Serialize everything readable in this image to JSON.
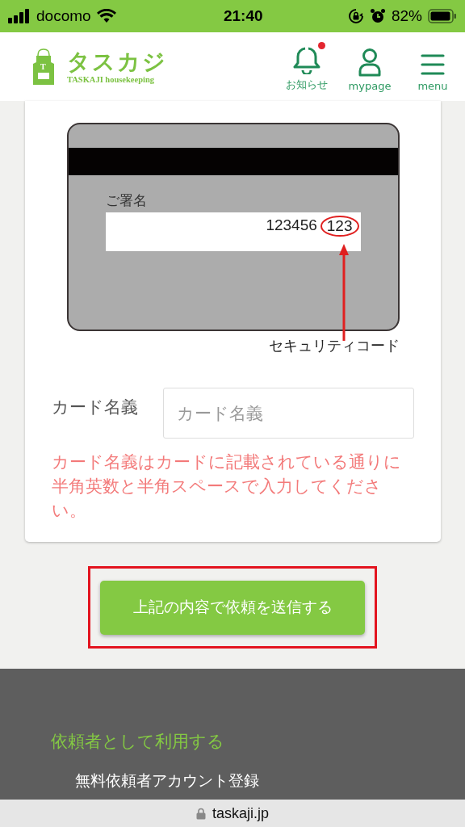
{
  "status_bar": {
    "carrier": "docomo",
    "time": "21:40",
    "battery": "82%"
  },
  "header": {
    "logo_mark": "T",
    "logo_title": "タスカジ",
    "logo_subtitle": "TASKAJI housekeeping",
    "nav": [
      {
        "label": "お知らせ",
        "kind": "bell",
        "badge": true
      },
      {
        "label": "mypage",
        "kind": "person",
        "badge": false
      },
      {
        "label": "menu",
        "kind": "menu",
        "badge": false
      }
    ]
  },
  "card_illustration": {
    "signature_label": "ご署名",
    "number": "123456",
    "security_code": "123",
    "caption": "セキュリティコード"
  },
  "form": {
    "label": "カード名義",
    "placeholder": "カード名義",
    "note": "カード名義はカードに記載されている通りに半角英数と半角スペースで入力してください。"
  },
  "submit_button": "上記の内容で依頼を送信する",
  "footer": {
    "heading": "依頼者として利用する",
    "links": [
      "無料依頼者アカウント登録"
    ]
  },
  "browser_bar": {
    "url": "taskaji.jp"
  }
}
